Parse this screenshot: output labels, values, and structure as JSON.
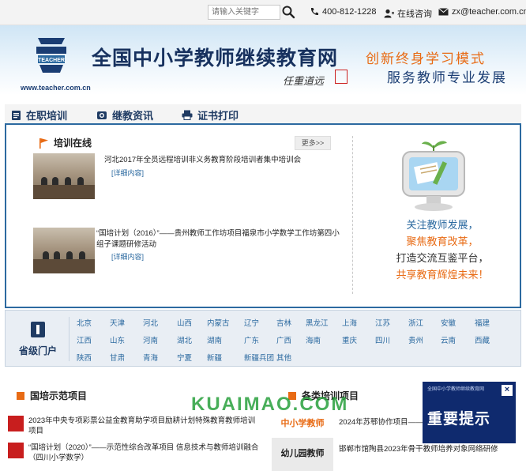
{
  "topbar": {
    "search_placeholder": "请输入关键字",
    "phone": "400-812-1228",
    "consult": "在线咨询",
    "email": "zx@teacher.com.cn"
  },
  "banner": {
    "url": "www.teacher.com.cn",
    "title": "全国中小学教师继续教育网",
    "signature": "任重道远",
    "slogan_1": "创新终身学习模式",
    "slogan_2": "服务教师专业发展"
  },
  "nav": {
    "tabs": [
      {
        "label": "在职培训",
        "icon": "document-icon"
      },
      {
        "label": "继教资讯",
        "icon": "camera-icon"
      },
      {
        "label": "证书打印",
        "icon": "printer-icon"
      }
    ]
  },
  "training": {
    "heading": "培训在线",
    "more": "更多>>",
    "news": [
      {
        "title": "河北2017年全员远程培训非义务教育阶段培训者集中培训会",
        "detail": "[详细内容]"
      },
      {
        "title": "“国培计划（2016）”——贵州教师工作坊项目福泉市小学数学工作坊第四小组子课题研修活动",
        "detail": "[详细内容]"
      }
    ],
    "mission": [
      "关注教师发展，",
      "聚焦教育改革，",
      "打造交流互鉴平台，",
      "共享教育辉煌未来！"
    ]
  },
  "provinces": {
    "heading": "省级门户",
    "rows": [
      [
        "北京",
        "天津",
        "河北",
        "山西",
        "内蒙古",
        "辽宁",
        "吉林",
        "黑龙江",
        "上海",
        "江苏",
        "浙江",
        "安徽",
        "福建"
      ],
      [
        "江西",
        "山东",
        "河南",
        "湖北",
        "湖南",
        "广东",
        "广西",
        "海南",
        "重庆",
        "四川",
        "贵州",
        "云南",
        "西藏"
      ],
      [
        "陕西",
        "甘肃",
        "青海",
        "宁夏",
        "新疆",
        "新疆兵团",
        "其他"
      ]
    ]
  },
  "demo": {
    "heading": "国培示范项目",
    "items": [
      "2023年中央专项彩票公益金教育助学项目励耕计划特殊教育教师培训项目",
      "“国培计划（2020）”——示范性综合改革项目 信息技术与教师培训融合（四川小学数学）"
    ]
  },
  "categories": {
    "heading": "各类培训项目",
    "tabs": [
      "中小学教师",
      "幼儿园教师"
    ],
    "items": [
      "2024年苏鄂协作项目——",
      "邯郸市馆陶县2023年骨干教师培养对象网络研修"
    ]
  },
  "popup": {
    "mini_text": "全国中小学教师继续教育网",
    "text": "重要提示",
    "close": "×"
  },
  "watermark": {
    "text": "KUAIMAO.COM"
  },
  "colors": {
    "brand_blue": "#2c6aa0",
    "accent_orange": "#e86b15",
    "navy": "#1f3b63"
  }
}
